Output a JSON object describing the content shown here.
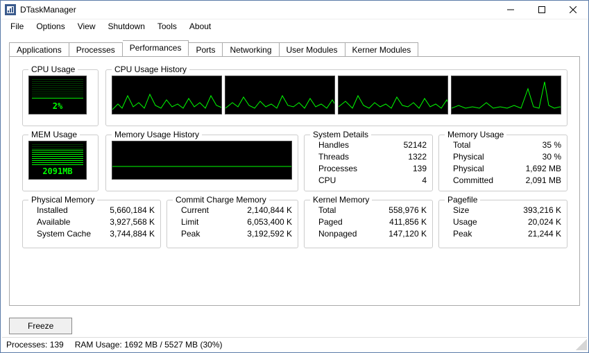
{
  "window": {
    "title": "DTaskManager"
  },
  "menu": {
    "file": "File",
    "options": "Options",
    "view": "View",
    "shutdown": "Shutdown",
    "tools": "Tools",
    "about": "About"
  },
  "tabs": {
    "applications": "Applications",
    "processes": "Processes",
    "performances": "Performances",
    "ports": "Ports",
    "networking": "Networking",
    "user_modules": "User Modules",
    "kerner_modules": "Kerner Modules"
  },
  "panels": {
    "cpu_usage": {
      "label": "CPU Usage",
      "value": "2%"
    },
    "cpu_history": {
      "label": "CPU Usage History"
    },
    "mem_usage": {
      "label": "MEM Usage",
      "value": "2091MB"
    },
    "mem_history": {
      "label": "Memory Usage History"
    },
    "system_details": {
      "label": "System Details",
      "handles_k": "Handles",
      "handles_v": "52142",
      "threads_k": "Threads",
      "threads_v": "1322",
      "processes_k": "Processes",
      "processes_v": "139",
      "cpu_k": "CPU",
      "cpu_v": "4"
    },
    "memory_usage": {
      "label": "Memory Usage",
      "total_k": "Total",
      "total_v": "35 %",
      "physical_pct_k": "Physical",
      "physical_pct_v": "30 %",
      "physical_mb_k": "Physical",
      "physical_mb_v": "1,692 MB",
      "committed_k": "Committed",
      "committed_v": "2,091 MB"
    },
    "physical_memory": {
      "label": "Physical Memory",
      "installed_k": "Installed",
      "installed_v": "5,660,184 K",
      "available_k": "Available",
      "available_v": "3,927,568 K",
      "syscache_k": "System Cache",
      "syscache_v": "3,744,884 K"
    },
    "commit_charge": {
      "label": "Commit Charge Memory",
      "current_k": "Current",
      "current_v": "2,140,844 K",
      "limit_k": "Limit",
      "limit_v": "6,053,400 K",
      "peak_k": "Peak",
      "peak_v": "3,192,592 K"
    },
    "kernel_memory": {
      "label": "Kernel Memory",
      "total_k": "Total",
      "total_v": "558,976 K",
      "paged_k": "Paged",
      "paged_v": "411,856 K",
      "nonpaged_k": "Nonpaged",
      "nonpaged_v": "147,120 K"
    },
    "pagefile": {
      "label": "Pagefile",
      "size_k": "Size",
      "size_v": "393,216 K",
      "usage_k": "Usage",
      "usage_v": "20,024 K",
      "peak_k": "Peak",
      "peak_v": "21,244 K"
    }
  },
  "buttons": {
    "freeze": "Freeze"
  },
  "statusbar": {
    "processes": "Processes: 139",
    "ram": "RAM Usage:  1692 MB / 5527 MB (30%)"
  }
}
